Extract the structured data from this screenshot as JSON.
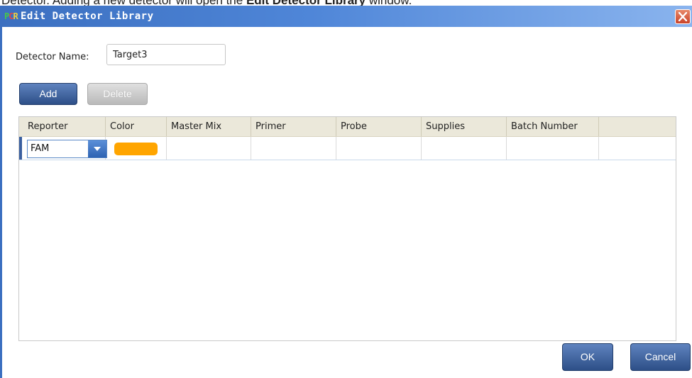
{
  "caption": {
    "prefix": "Detector. Adding a new detector will open the ",
    "bold": "Edit Detector Library",
    "suffix": " window."
  },
  "window": {
    "title": "Edit Detector Library",
    "logo": {
      "p": "P",
      "c": "C",
      "r": "R"
    }
  },
  "form": {
    "detector_name_label": "Detector Name:",
    "detector_name_value": "Target3"
  },
  "toolbar": {
    "add_label": "Add",
    "delete_label": "Delete"
  },
  "grid": {
    "columns": [
      "Reporter",
      "Color",
      "Master Mix",
      "Primer",
      "Probe",
      "Supplies",
      "Batch Number"
    ],
    "rows": [
      {
        "reporter": "FAM",
        "color": "#FFA500",
        "master_mix": "",
        "primer": "",
        "probe": "",
        "supplies": "",
        "batch_number": ""
      }
    ]
  },
  "footer": {
    "ok_label": "OK",
    "cancel_label": "Cancel"
  },
  "colors": {
    "accent": "#3b6fc0",
    "button_primary": "#2d4f87",
    "close": "#c9432a"
  }
}
